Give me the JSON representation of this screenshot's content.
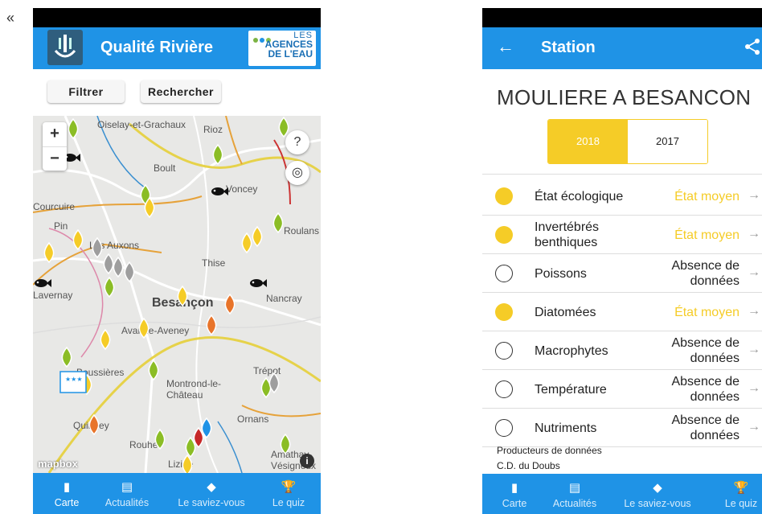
{
  "page": {
    "left_quote": "«"
  },
  "left": {
    "app_title": "Qualité Rivière",
    "agency_logo": {
      "line1": "LES",
      "line2": "AGENCES",
      "line3": "DE L'EAU",
      "dot_colors": [
        "#7cb342",
        "#1f93e6",
        "#8bc34a"
      ]
    },
    "toolbar": {
      "filter_label": "Filtrer",
      "search_label": "Rechercher"
    },
    "map": {
      "zoom_in": "+",
      "zoom_out": "−",
      "attribution": "mapbox",
      "places": [
        "Oiselay-et-Grachaux",
        "Rioz",
        "Boult",
        "Voncey",
        "Courcuire",
        "Pin",
        "Les Auxons",
        "Roulans",
        "Thise",
        "Lavernay",
        "Nancray",
        "Besançon",
        "Avanne-Aveney",
        "Trépot",
        "Boussières",
        "Montrond-le-Château",
        "Quingey",
        "Rouhe",
        "Ornans",
        "Amathay-Vésigneux",
        "Lizine"
      ]
    },
    "nav": [
      {
        "icon": "map-icon",
        "label": "Carte",
        "active": true
      },
      {
        "icon": "news-icon",
        "label": "Actualités",
        "active": false
      },
      {
        "icon": "graduation-cap-icon",
        "label": "Le saviez-vous",
        "active": false
      },
      {
        "icon": "trophy-icon",
        "label": "Le quiz",
        "active": false
      }
    ]
  },
  "right": {
    "header_title": "Station",
    "station_name": "MOULIERE A BESANCON",
    "years": [
      {
        "label": "2018",
        "selected": true
      },
      {
        "label": "2017",
        "selected": false
      }
    ],
    "rows": [
      {
        "label": "État écologique",
        "value": "État moyen",
        "status": "moyen"
      },
      {
        "label": "Invertébrés benthiques",
        "value": "État moyen",
        "status": "moyen"
      },
      {
        "label": "Poissons",
        "value": "Absence de données",
        "status": "absent"
      },
      {
        "label": "Diatomées",
        "value": "État moyen",
        "status": "moyen"
      },
      {
        "label": "Macrophytes",
        "value": "Absence de données",
        "status": "absent"
      },
      {
        "label": "Température",
        "value": "Absence de données",
        "status": "absent"
      },
      {
        "label": "Nutriments",
        "value": "Absence de données",
        "status": "absent"
      }
    ],
    "producers_label": "Producteurs de données",
    "producer": "C.D. du Doubs",
    "colors": {
      "moyen": "#f5cc27",
      "primary": "#1f93e6"
    },
    "nav": [
      {
        "icon": "map-icon",
        "label": "Carte",
        "active": true
      },
      {
        "icon": "news-icon",
        "label": "Actualités",
        "active": false
      },
      {
        "icon": "graduation-cap-icon",
        "label": "Le saviez-vous",
        "active": false
      },
      {
        "icon": "trophy-icon",
        "label": "Le quiz",
        "active": false
      }
    ]
  }
}
